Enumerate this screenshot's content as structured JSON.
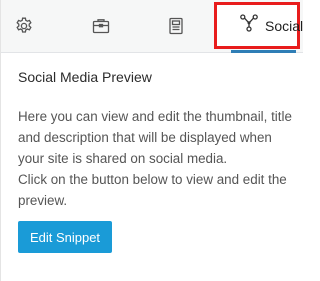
{
  "tabs": [
    {
      "icon": "gear-icon"
    },
    {
      "icon": "briefcase-icon"
    },
    {
      "icon": "document-icon"
    },
    {
      "icon": "share-nodes-icon",
      "label": "Social",
      "active": true
    }
  ],
  "panel": {
    "heading": "Social Media Preview",
    "description": "Here you can view and edit the thumbnail, title and description that will be displayed when your site is shared on social media.",
    "instruction": "Click on the button below to view and edit the preview.",
    "button_label": "Edit Snippet"
  },
  "colors": {
    "accent": "#1a9bd7",
    "highlight_border": "#e81c1c",
    "active_underline": "#2f7eb6"
  }
}
